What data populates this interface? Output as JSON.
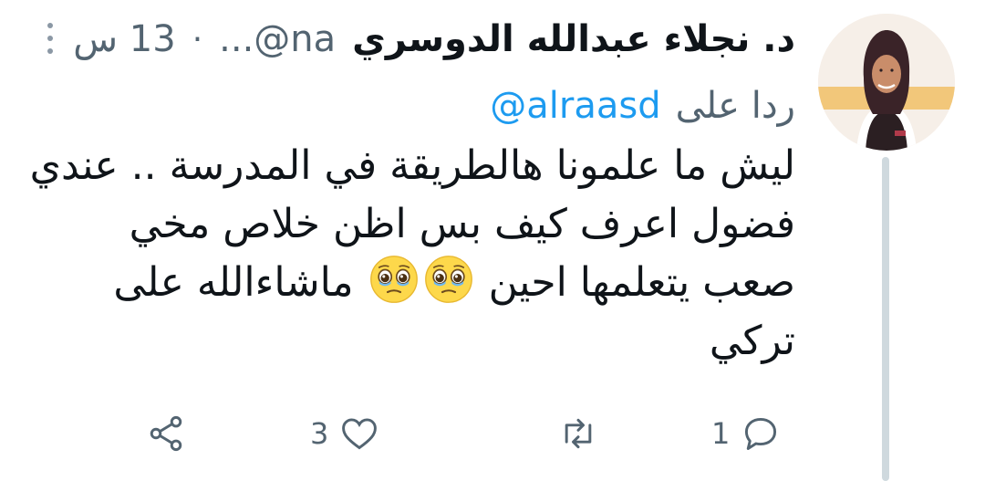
{
  "author": {
    "display_name": "د. نجلاء عبدالله الدوسري",
    "handle": "...@na",
    "separator": "·",
    "time": "13 س"
  },
  "reply": {
    "label": "ردا على",
    "target": "@alraasd"
  },
  "body": {
    "line1": "ليش ما علمونا هالطريقة في المدرسة .. عندي",
    "line2": "فضول اعرف كيف بس اظن خلاص مخي",
    "line3_start": "صعب يتعلمها احين",
    "line3_end": "ماشاءالله على",
    "line4": "تركي",
    "emoji_name": "face-holding-back-tears-icon"
  },
  "actions": {
    "reply_count": "1",
    "retweet_count": "",
    "like_count": "3",
    "share_count": ""
  },
  "colors": {
    "text": "#0f1419",
    "secondary": "#536471",
    "link": "#1d9bf0",
    "thread_line": "#cfd9de"
  }
}
